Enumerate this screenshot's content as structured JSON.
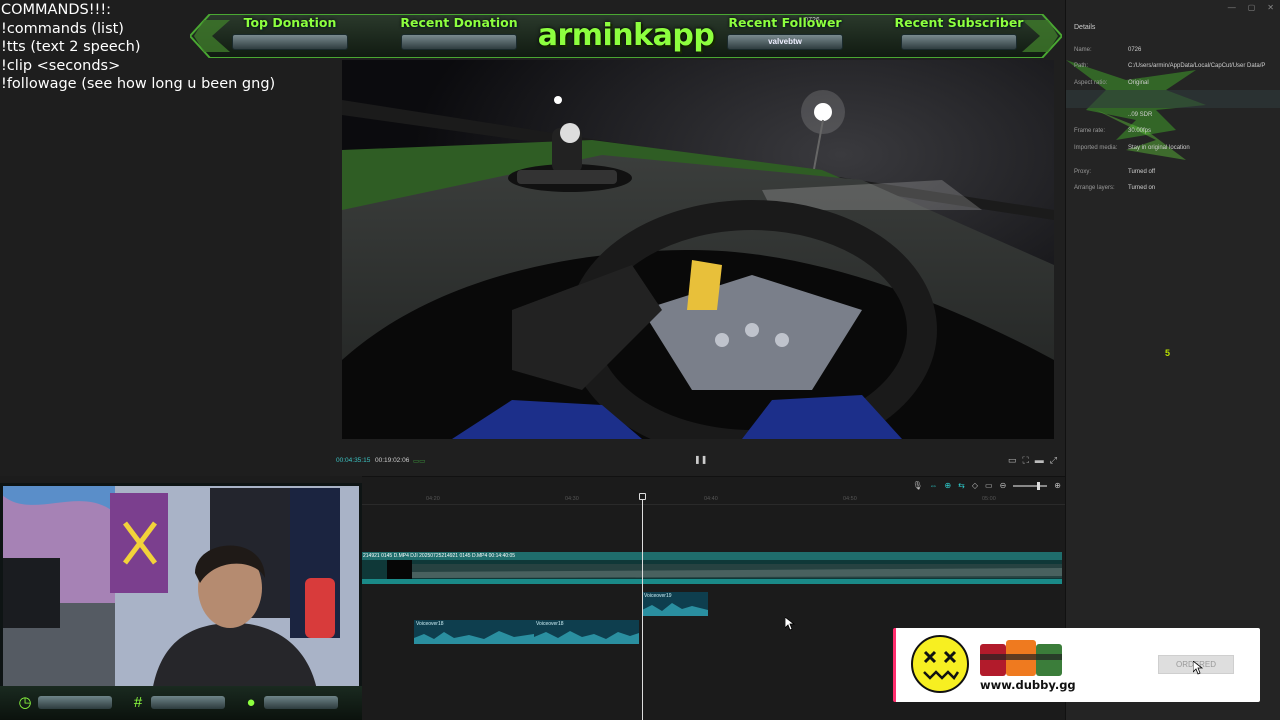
{
  "commands": {
    "lines": [
      "COMMANDS!!!:",
      "!commands (list)",
      "!tts (text 2 speech)",
      "!clip <seconds>",
      "!followage (see how long u been gng)"
    ]
  },
  "banner": {
    "top_id": "0726",
    "brand": "arminkapp",
    "slots": [
      {
        "title": "Top Donation",
        "value": ""
      },
      {
        "title": "Recent Donation",
        "value": ""
      },
      {
        "title": "Recent Follower",
        "value": "valvebtw"
      },
      {
        "title": "Recent Subscriber",
        "value": ""
      }
    ],
    "accent": "#8dff3f"
  },
  "player": {
    "current_time": "00:04:35:15",
    "total_time": "00:19:02:06",
    "extra": "▭▭"
  },
  "details": {
    "title": "Details",
    "rows": [
      {
        "label": "Name:",
        "value": "0726"
      },
      {
        "label": "Path:",
        "value": "C:/Users/armin/AppData/Local/CapCut/User Data/P"
      },
      {
        "label": "Aspect ratio:",
        "value": "Original"
      },
      {
        "label": "",
        "value": "..09 SDR"
      },
      {
        "label": "Frame rate:",
        "value": "30.00fps"
      },
      {
        "label": "Imported media:",
        "value": "Stay in original location"
      },
      {
        "label": "Proxy:",
        "value": "Turned off"
      },
      {
        "label": "Arrange layers:",
        "value": "Turned on"
      }
    ],
    "green_number": "5"
  },
  "timeline": {
    "ruler": [
      "04:20",
      "04:30",
      "04:40",
      "04:50",
      "05:00"
    ],
    "video_track_label": "214921 0145 D.MP4   DJI 20250725214921 0145 D.MP4   00:14:40:05",
    "voiceovers": [
      "Voiceover18",
      "Voiceover18",
      "Voiceover19"
    ]
  },
  "ad": {
    "url": "www.dubby.gg",
    "button": "ORDERED",
    "accent": "#ff2e6e"
  }
}
